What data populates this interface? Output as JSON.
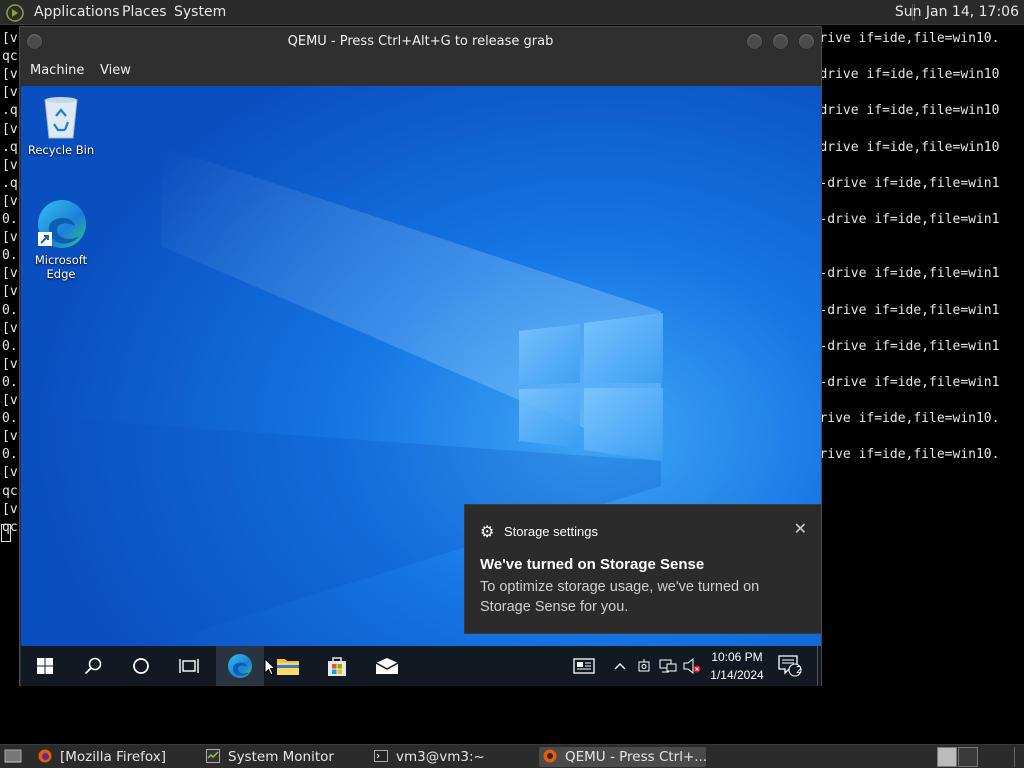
{
  "topbar": {
    "menus": [
      "Applications",
      "Places",
      "System"
    ],
    "clock": "Sun Jan 14, 17:06"
  },
  "terminal": {
    "left_lines": [
      "[v",
      "qc",
      "[v",
      "[v",
      ".q",
      "[v",
      ".q",
      "[v",
      ".q",
      "[v",
      "0.",
      "[v",
      "0.",
      "[v",
      "[v",
      "0.",
      "[v",
      "0.",
      "[v",
      "0.",
      "[v",
      "0.",
      "[v",
      "0.",
      "[v",
      "qc",
      "[v",
      "qc"
    ],
    "right_lines": [
      {
        "row": 0,
        "text": "drive if=ide,file=win10."
      },
      {
        "row": 2,
        "text": "drive if=ide,file=win10"
      },
      {
        "row": 4,
        "text": "drive if=ide,file=win10"
      },
      {
        "row": 6,
        "text": "drive if=ide,file=win10"
      },
      {
        "row": 8,
        "text": "-drive if=ide,file=win1"
      },
      {
        "row": 10,
        "text": "-drive if=ide,file=win1"
      },
      {
        "row": 13,
        "text": "-drive if=ide,file=win1"
      },
      {
        "row": 15,
        "text": "-drive if=ide,file=win1"
      },
      {
        "row": 17,
        "text": "-drive if=ide,file=win1"
      },
      {
        "row": 19,
        "text": "-drive if=ide,file=win1"
      },
      {
        "row": 21,
        "text": "rive if=ide,file=win10."
      },
      {
        "row": 23,
        "text": "rive if=ide,file=win10."
      }
    ]
  },
  "qemu": {
    "title": "QEMU - Press Ctrl+Alt+G to release grab",
    "menu": [
      "Machine",
      "View"
    ]
  },
  "desktop": {
    "icons": [
      {
        "label": "Recycle Bin",
        "icon": "recycle-bin-icon"
      },
      {
        "label": "Microsoft Edge",
        "icon": "edge-icon"
      }
    ]
  },
  "toast": {
    "app": "Storage settings",
    "heading": "We've turned on Storage Sense",
    "body": "To optimize storage usage, we've turned on Storage Sense for you."
  },
  "win_taskbar": {
    "time": "10:06 PM",
    "date": "1/14/2024",
    "notifications": "2"
  },
  "bottombar": {
    "tasks": [
      {
        "label": "[Mozilla Firefox]",
        "icon": "firefox-icon",
        "active": false
      },
      {
        "label": "System Monitor",
        "icon": "system-monitor-icon",
        "active": false
      },
      {
        "label": "vm3@vm3:~",
        "icon": "terminal-icon",
        "active": false
      },
      {
        "label": "QEMU - Press Ctrl+...",
        "icon": "qemu-icon",
        "active": true
      }
    ]
  },
  "colors": {
    "wallpaper": "#0c67d6",
    "toast_bg": "#2b2b2b",
    "panel_bg": "#2b2b2b"
  }
}
